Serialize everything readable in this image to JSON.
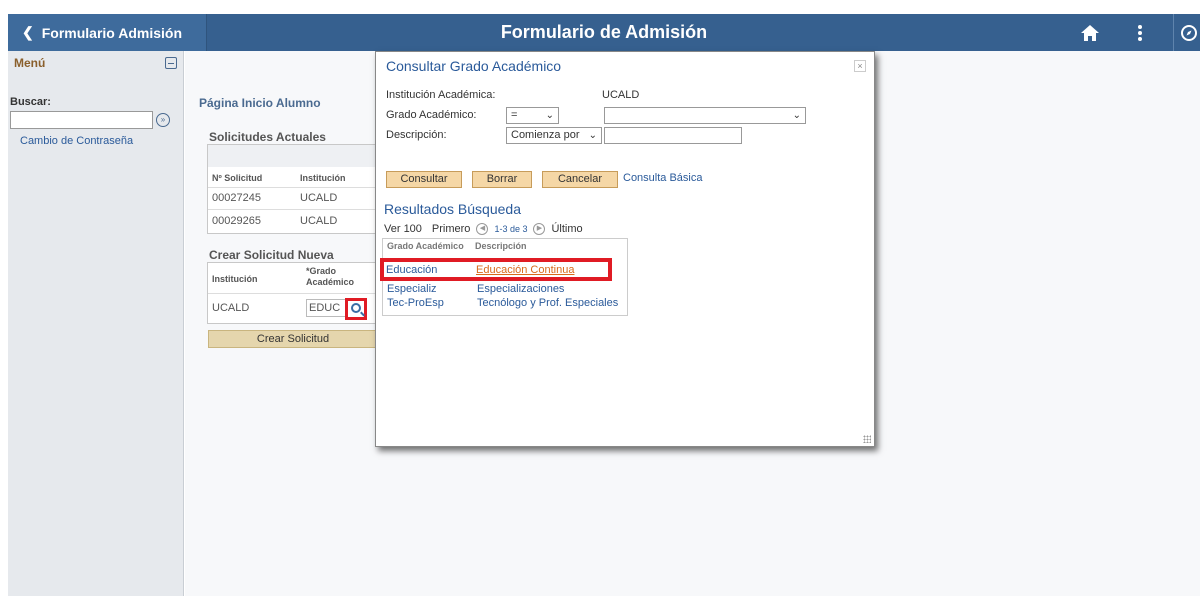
{
  "header": {
    "back_label": "Formulario Admisión",
    "title": "Formulario de Admisión",
    "icons": [
      "home-icon",
      "kebab-menu-icon",
      "navbar-icon"
    ]
  },
  "leftnav": {
    "title": "Menú",
    "search_label": "Buscar:",
    "search_value": "",
    "links": [
      "Cambio de Contraseña"
    ]
  },
  "main": {
    "page_title": "Página Inicio Alumno",
    "current_title": "Solicitudes Actuales",
    "current_headers": [
      "Nº Solicitud",
      "Institución"
    ],
    "current_rows": [
      [
        "00027245",
        "UCALD"
      ],
      [
        "00029265",
        "UCALD"
      ]
    ],
    "new_title": "Crear Solicitud Nueva",
    "new_headers": [
      "Institución",
      "*Grado Académico"
    ],
    "new_row": {
      "institution": "UCALD",
      "grade_value": "EDUC"
    },
    "create_button": "Crear Solicitud"
  },
  "modal": {
    "title": "Consultar Grado Académico",
    "close_label": "×",
    "institution_label": "Institución Académica:",
    "institution_value": "UCALD",
    "grade_label": "Grado Académico:",
    "grade_operator": "=",
    "grade_value": "",
    "description_label": "Descripción:",
    "description_operator": "Comienza por",
    "description_value": "",
    "buttons": {
      "search": "Consultar",
      "clear": "Borrar",
      "cancel": "Cancelar"
    },
    "basic_lookup": "Consulta Básica",
    "results_title": "Resultados Búsqueda",
    "pager": {
      "view": "Ver 100",
      "first": "Primero",
      "range": "1-3 de 3",
      "last": "Último"
    },
    "result_headers": [
      "Grado Académico",
      "Descripción"
    ],
    "results": [
      {
        "code": "Educación",
        "description": "Educación Continua"
      },
      {
        "code": "Especializ",
        "description": "Especializaciones"
      },
      {
        "code": "Tec-ProEsp",
        "description": "Tecnólogo y Prof. Especiales"
      }
    ]
  },
  "colors": {
    "header": "#36608f",
    "highlight": "#e01b24",
    "button": "#f5d7a6"
  }
}
